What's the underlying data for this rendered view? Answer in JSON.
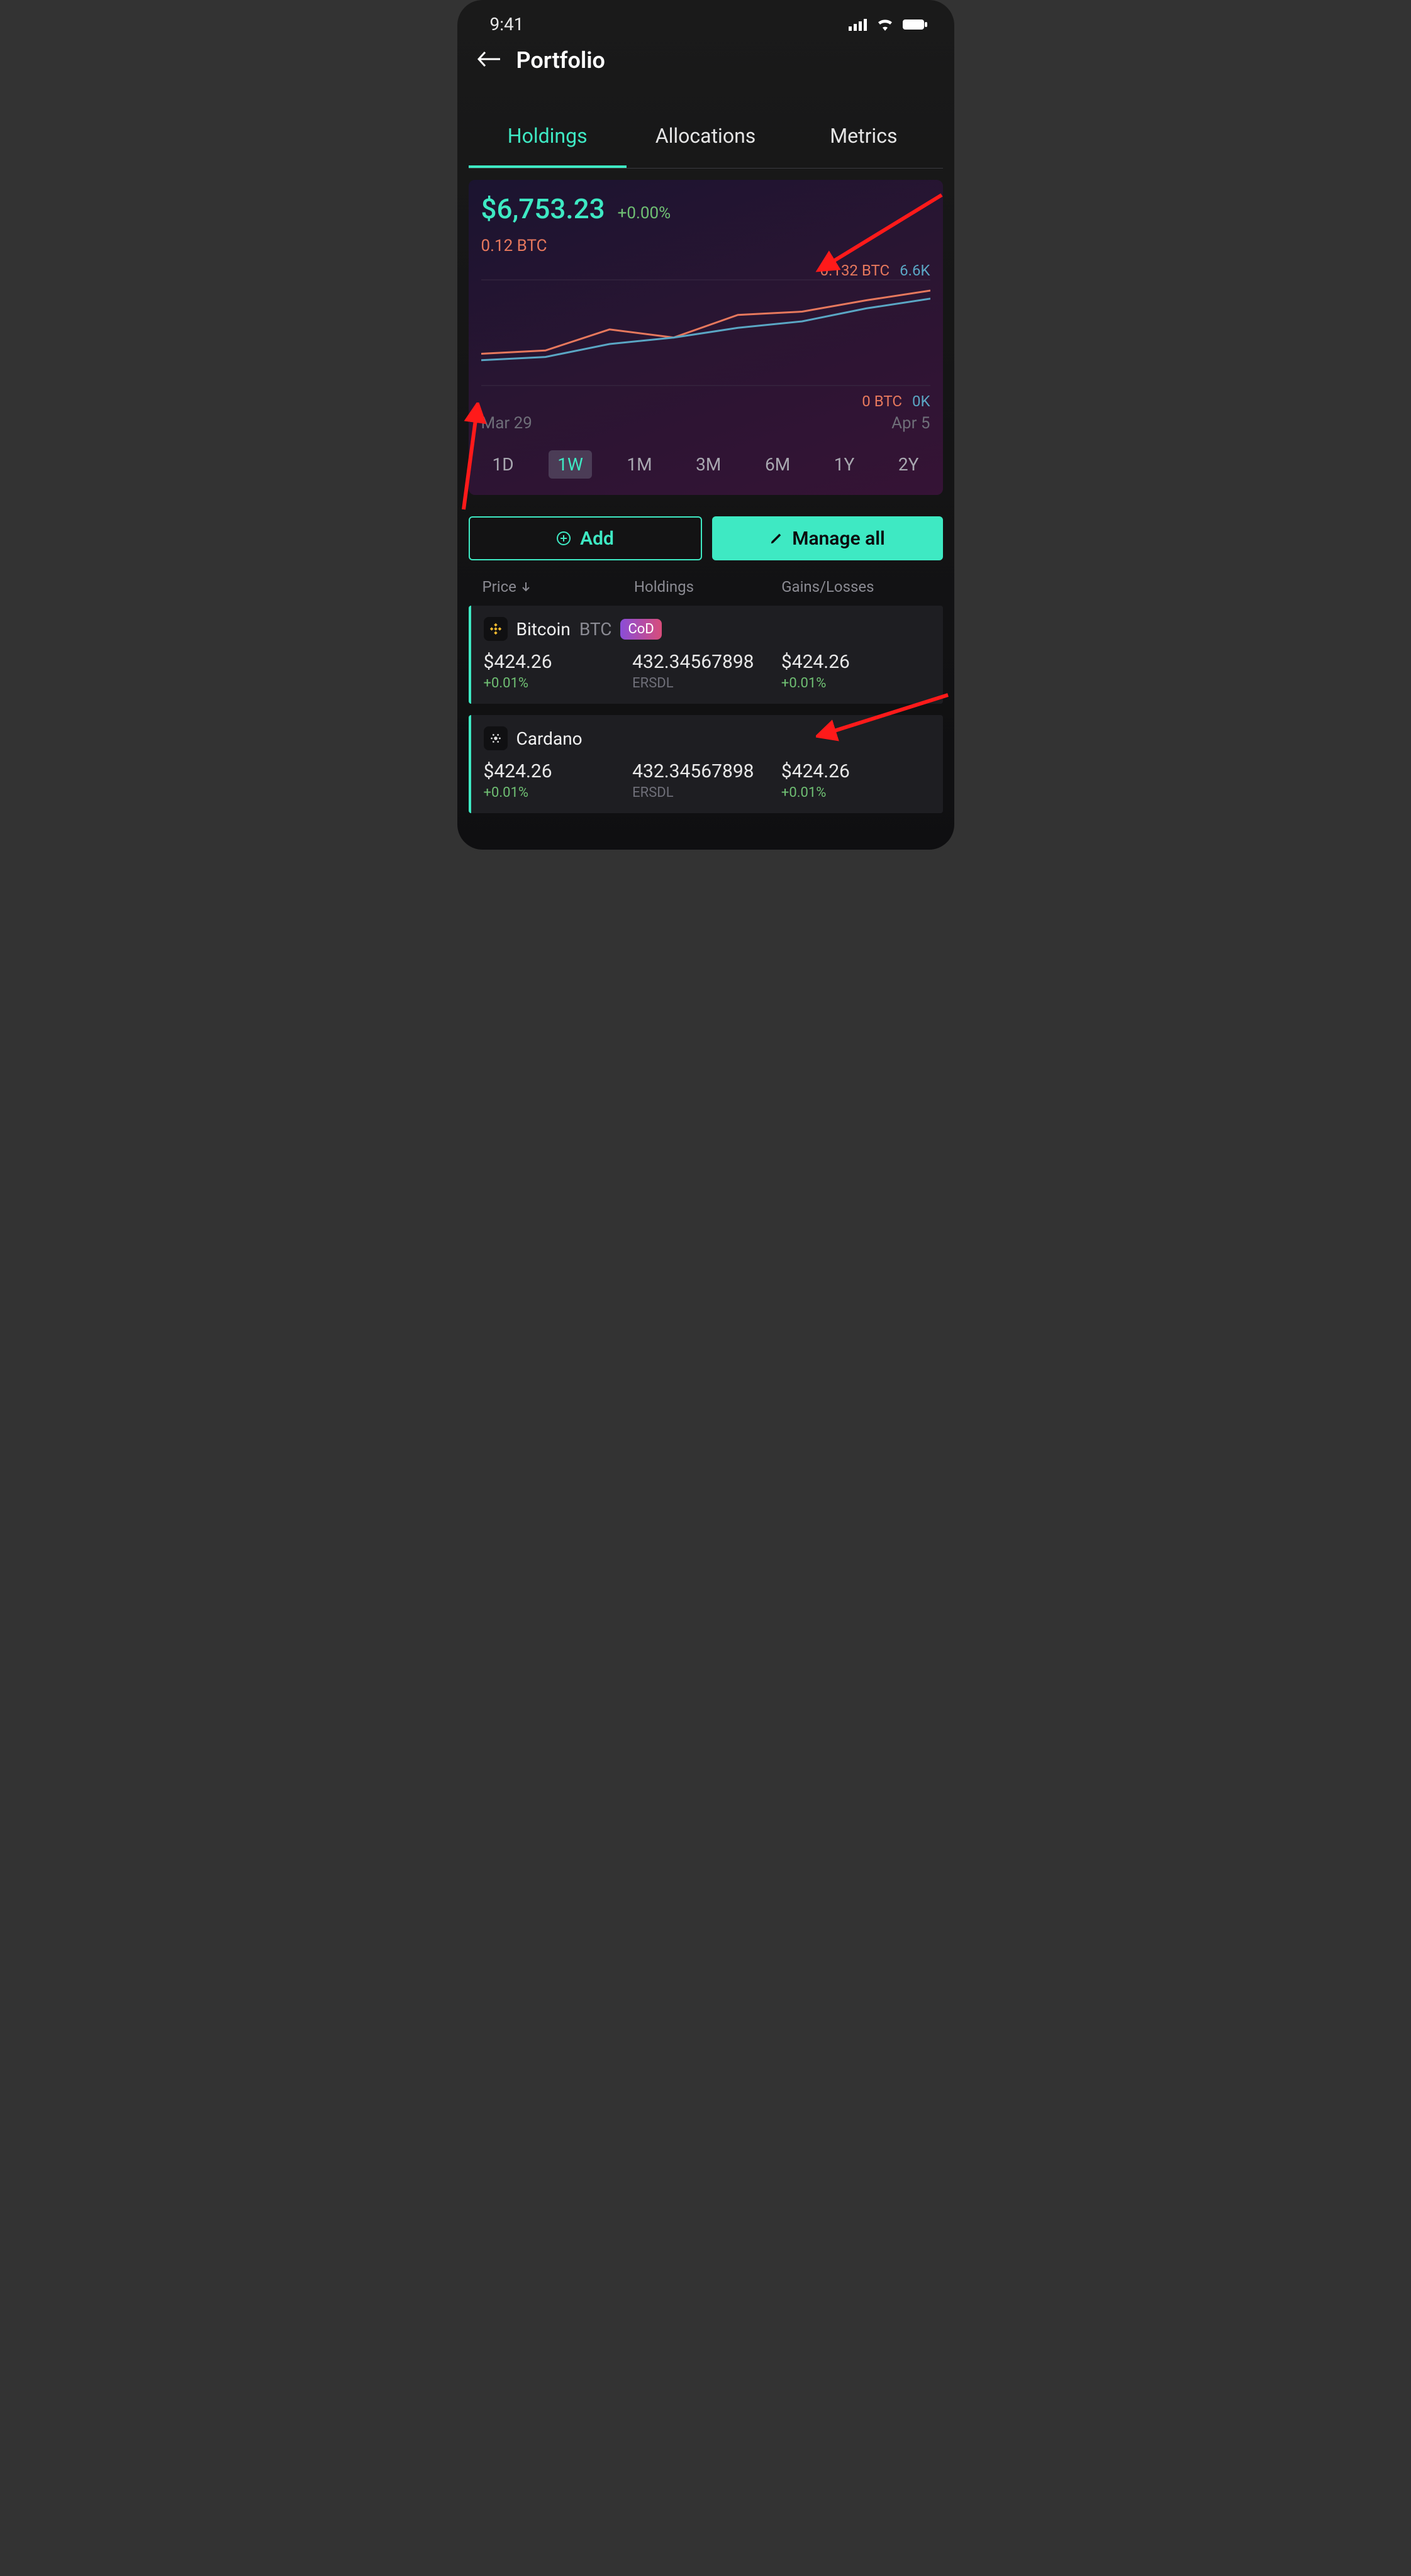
{
  "status": {
    "time": "9:41"
  },
  "header": {
    "title": "Portfolio"
  },
  "tabs": [
    {
      "label": "Holdings",
      "active": true
    },
    {
      "label": "Allocations",
      "active": false
    },
    {
      "label": "Metrics",
      "active": false
    }
  ],
  "balance": {
    "fiat": "$6,753.23",
    "change_pct": "+0.00%",
    "btc": "0.12 BTC"
  },
  "chart_axis": {
    "top_btc": "0.132 BTC",
    "top_usd": "6.6K",
    "bottom_btc": "0 BTC",
    "bottom_usd": "0K"
  },
  "chart_dates": {
    "start": "Mar 29",
    "end": "Apr 5"
  },
  "ranges": [
    "1D",
    "1W",
    "1M",
    "3M",
    "6M",
    "1Y",
    "2Y"
  ],
  "range_active": "1W",
  "actions": {
    "add": "Add",
    "manage": "Manage all"
  },
  "columns": {
    "price": "Price",
    "holdings": "Holdings",
    "gains": "Gains/Losses"
  },
  "assets": [
    {
      "name": "Bitcoin",
      "ticker": "BTC",
      "badge": "CoD",
      "icon": "binance",
      "price": "$424.26",
      "price_change": "+0.01%",
      "holdings_amount": "432.34567898",
      "holdings_unit": "ERSDL",
      "gain": "$424.26",
      "gain_change": "+0.01%"
    },
    {
      "name": "Cardano",
      "ticker": "",
      "badge": "",
      "icon": "cardano",
      "price": "$424.26",
      "price_change": "+0.01%",
      "holdings_amount": "432.34567898",
      "holdings_unit": "ERSDL",
      "gain": "$424.26",
      "gain_change": "+0.01%"
    }
  ],
  "chart_data": {
    "type": "line",
    "x": [
      0,
      1,
      2,
      3,
      4,
      5,
      6,
      7
    ],
    "xlabel_start": "Mar 29",
    "xlabel_end": "Apr 5",
    "series": [
      {
        "name": "BTC",
        "color": "#e6785d",
        "values": [
          0.04,
          0.044,
          0.07,
          0.06,
          0.088,
          0.092,
          0.106,
          0.118
        ],
        "ylim": [
          0,
          0.132
        ],
        "yunit": "BTC"
      },
      {
        "name": "USD",
        "color": "#5aa6c4",
        "values": [
          1.6,
          1.8,
          2.6,
          3.0,
          3.6,
          4.0,
          4.8,
          5.4
        ],
        "ylim": [
          0,
          6.6
        ],
        "yunit": "K"
      }
    ]
  }
}
